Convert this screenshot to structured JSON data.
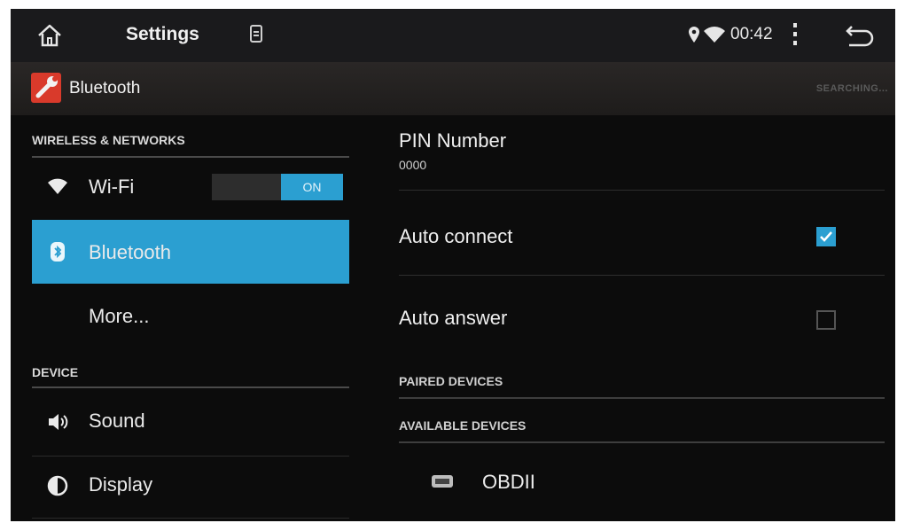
{
  "statusbar": {
    "title": "Settings",
    "time": "00:42",
    "icons": [
      "home-icon",
      "sd-card-icon",
      "location-icon",
      "wifi-icon",
      "overflow-menu-icon",
      "back-icon"
    ]
  },
  "actionbar": {
    "app_title": "Bluetooth",
    "status": "SEARCHING..."
  },
  "sidebar": {
    "section_wireless": "WIRELESS & NETWORKS",
    "wifi_label": "Wi-Fi",
    "wifi_toggle": "ON",
    "bluetooth_label": "Bluetooth",
    "more_label": "More...",
    "section_device": "DEVICE",
    "sound_label": "Sound",
    "display_label": "Display"
  },
  "main": {
    "pin_title": "PIN Number",
    "pin_value": "0000",
    "auto_connect_label": "Auto connect",
    "auto_connect_checked": true,
    "auto_answer_label": "Auto answer",
    "auto_answer_checked": false,
    "paired_devices": "PAIRED DEVICES",
    "available_devices": "AVAILABLE DEVICES",
    "devices": [
      {
        "name": "OBDII",
        "icon": "obd-device-icon"
      }
    ]
  },
  "colors": {
    "accent": "#2b9fd1",
    "background": "#0c0c0c",
    "statusbar": "#1a1a1c"
  }
}
